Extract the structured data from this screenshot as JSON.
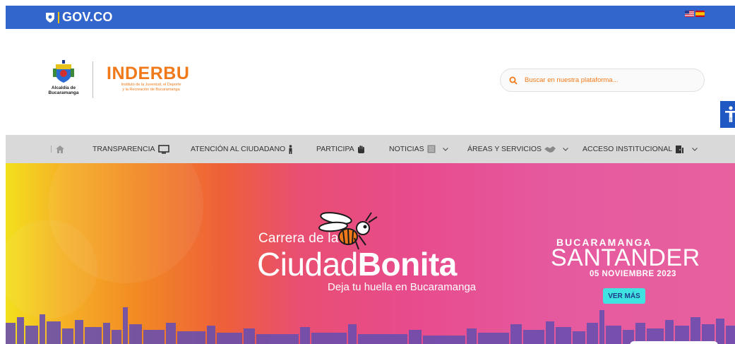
{
  "govbar": {
    "logo_text": "GOV.CO",
    "flags": [
      "english-flag",
      "spanish-flag"
    ],
    "color": "#3366cc"
  },
  "header": {
    "alcaldia_name": "Alcaldía de Bucaramanga",
    "alcaldia_line1": "Alcaldía de",
    "alcaldia_line2": "Bucaramanga",
    "inderbu_title": "INDERBU",
    "inderbu_sub1": "Instituto de la Juventud, el Deporte",
    "inderbu_sub2": "y la Recreación de Bucaramanga",
    "brand_color": "#f07a1a"
  },
  "search": {
    "placeholder": "Buscar en nuestra plataforma..."
  },
  "accessibility": {
    "icon": "accessibility-icon",
    "color": "#1f57c3"
  },
  "nav": {
    "home_icon": "home-icon",
    "items": [
      {
        "label": "TRANSPARENCIA",
        "icon": "monitor-icon",
        "dropdown": false
      },
      {
        "label": "ATENCIÓN AL CIUDADANO",
        "icon": "person-icon",
        "dropdown": false
      },
      {
        "label": "PARTICIPA",
        "icon": "hand-icon",
        "dropdown": false
      },
      {
        "label": "NOTICIAS",
        "icon": "newspaper-icon",
        "dropdown": true
      },
      {
        "label": "ÁREAS Y SERVICIOS",
        "icon": "handshake-icon",
        "dropdown": true
      },
      {
        "label": "ACCESO INSTITUCIONAL",
        "icon": "door-icon",
        "dropdown": true
      }
    ]
  },
  "banner": {
    "carrera": "Carrera de la",
    "ciudad": "Ciudad",
    "bonita": "Bonita",
    "deja": "Deja tu huella en Bucaramanga",
    "bucaramanga": "BUCARAMANGA",
    "santander": "SANTANDER",
    "fecha": "05 NOVIEMBRE 2023",
    "cta": "VER MÁS",
    "cta_color": "#3fe3e0"
  }
}
